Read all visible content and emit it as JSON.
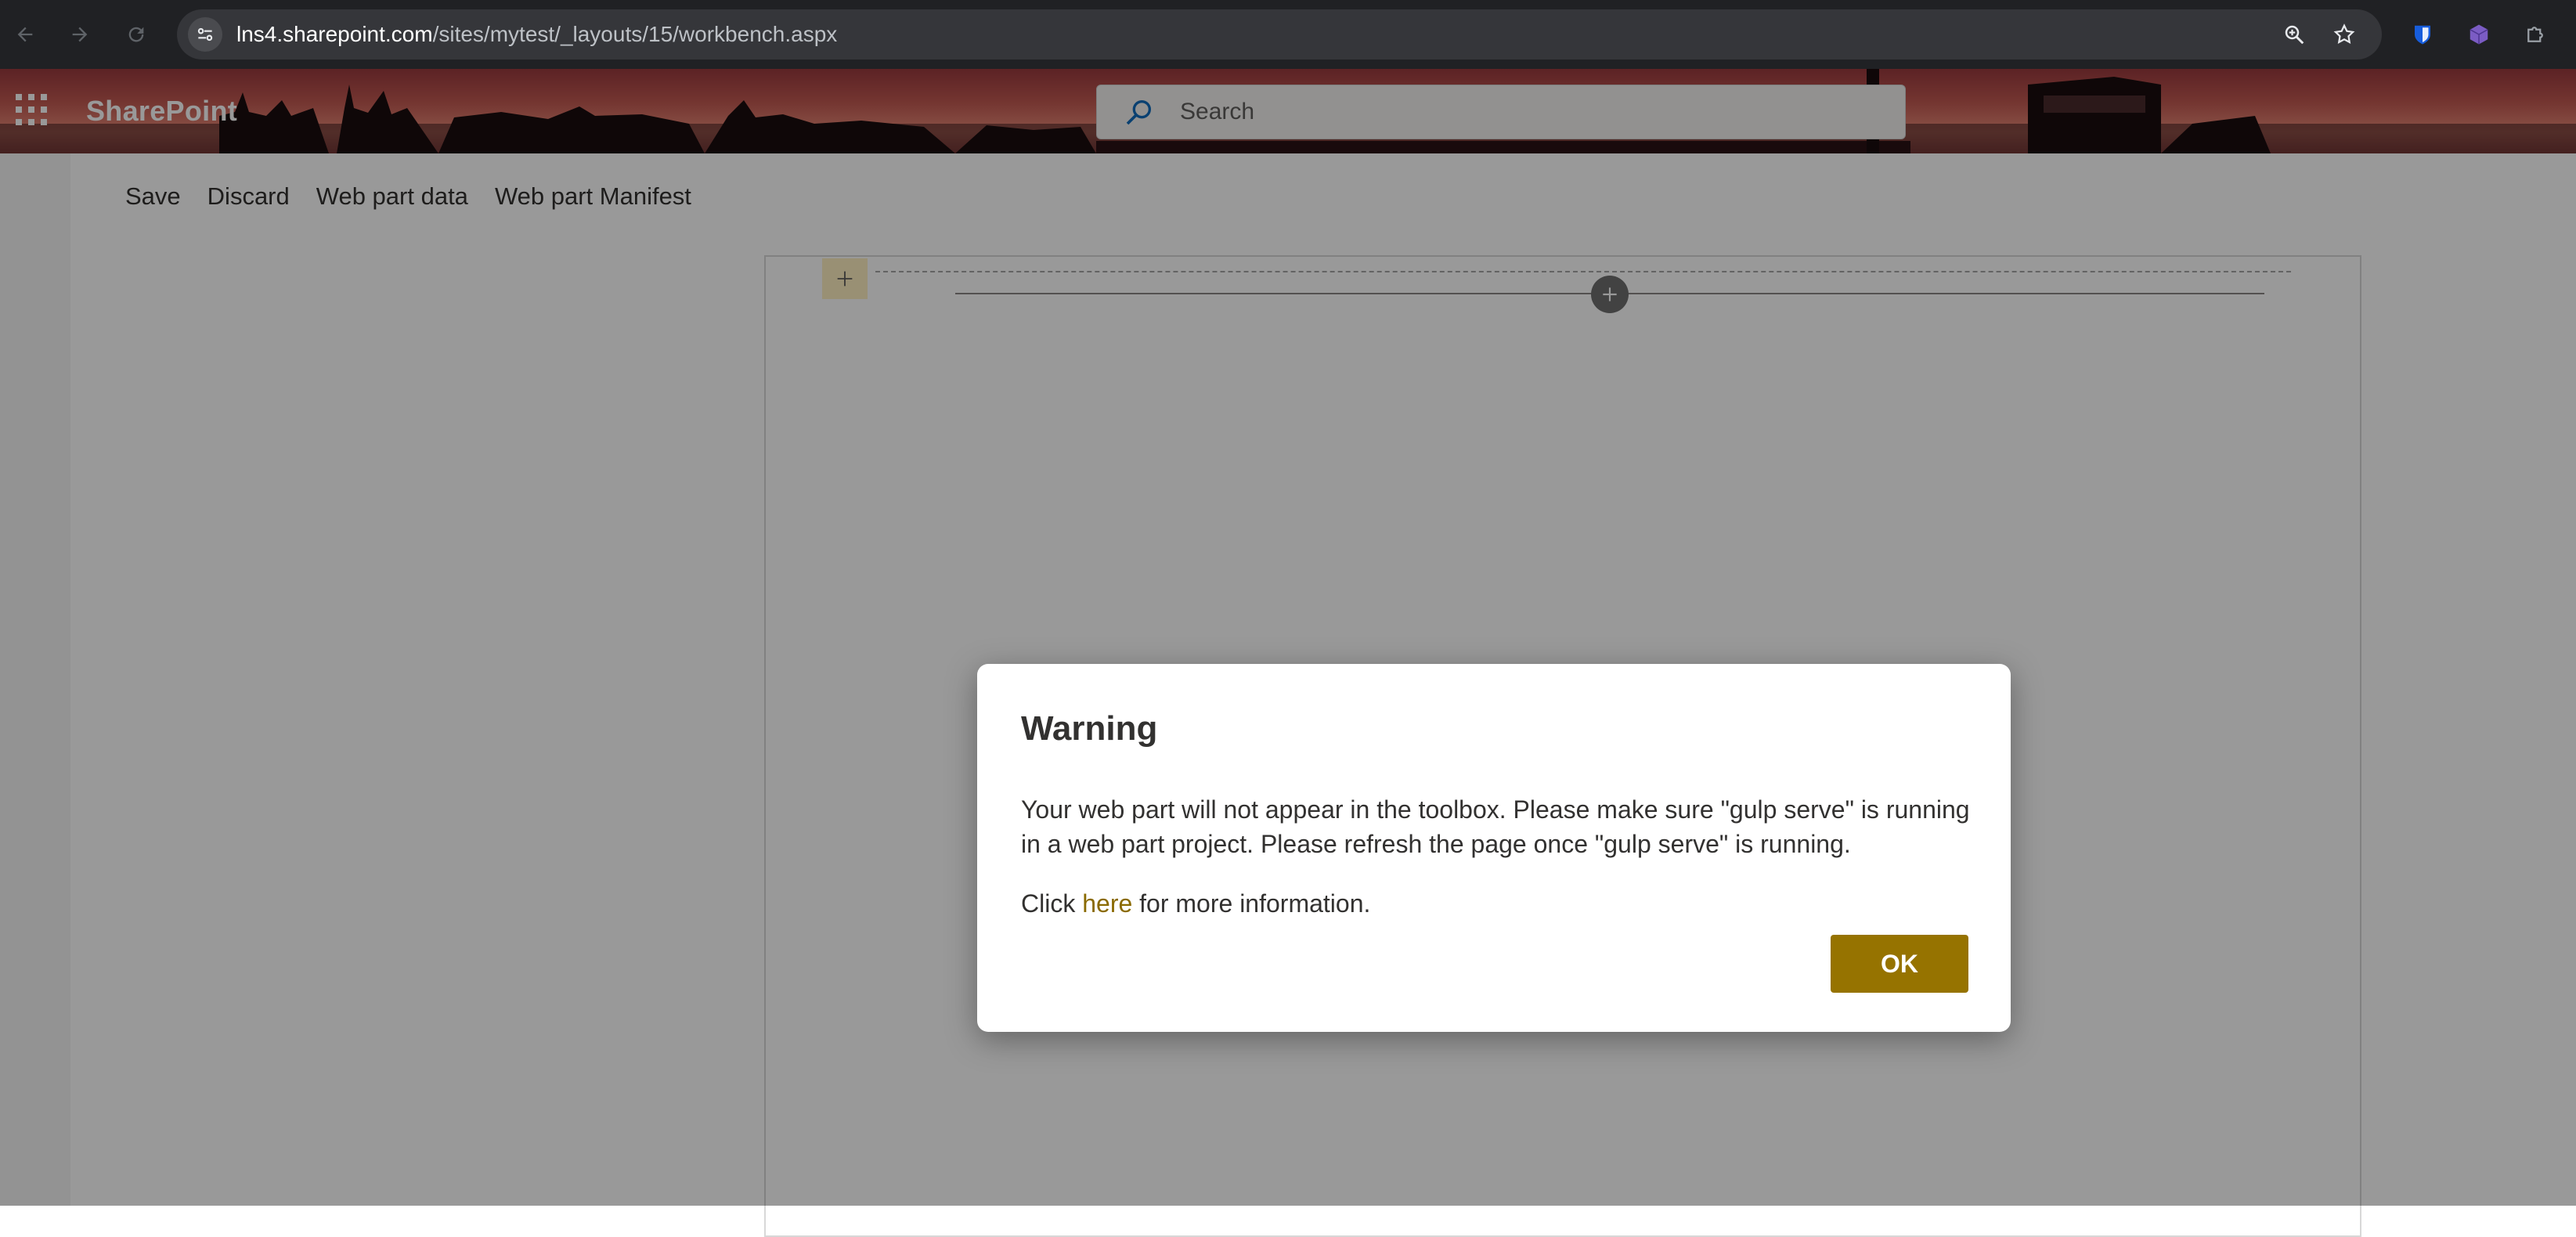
{
  "browser": {
    "url_host": "lns4.sharepoint.com",
    "url_path": "/sites/mytest/_layouts/15/workbench.aspx",
    "icons": [
      "back-icon",
      "forward-icon",
      "reload-icon",
      "site-settings-icon",
      "zoom-icon",
      "bookmark-star-icon",
      "bitwarden-extension-icon",
      "cube-extension-icon",
      "extensions-puzzle-icon"
    ]
  },
  "suitebar": {
    "brand": "SharePoint",
    "search_placeholder": "Search",
    "icons": [
      "app-launcher-waffle-icon",
      "search-icon"
    ]
  },
  "toolbar": {
    "save_label": "Save",
    "discard_label": "Discard",
    "webpart_data_label": "Web part data",
    "webpart_manifest_label": "Web part Manifest"
  },
  "dialog": {
    "title": "Warning",
    "message": "Your web part will not appear in the toolbox. Please make sure \"gulp serve\" is running in a web part project. Please refresh the page once \"gulp serve\" is running.",
    "info_prefix": "Click ",
    "info_link": "here",
    "info_suffix": " for more information.",
    "ok_label": "OK"
  },
  "colors": {
    "accent": "#967300",
    "link": "#8a6a00",
    "chrome_bg": "#202124"
  }
}
